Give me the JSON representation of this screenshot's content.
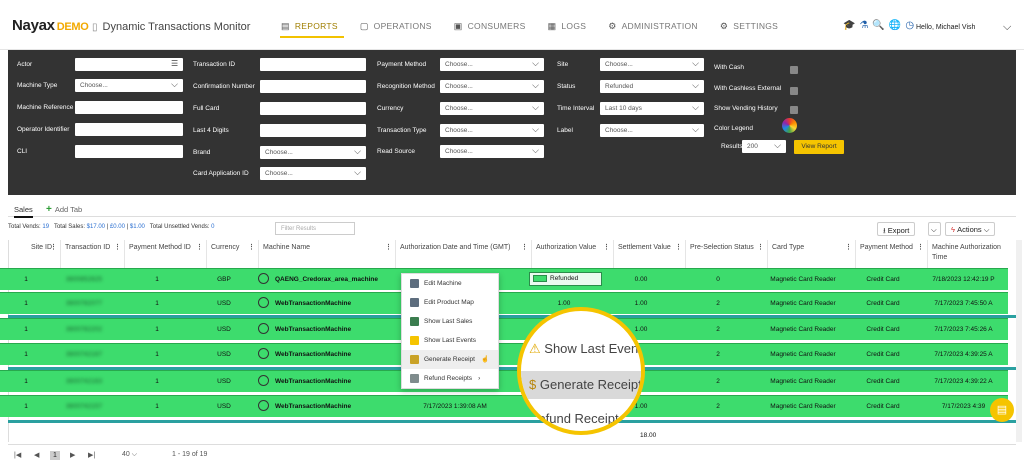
{
  "header": {
    "logo": "Nayax",
    "logo_demo": "DEMO",
    "app_title": "Dynamic Transactions Monitor",
    "nav": [
      {
        "label": "REPORTS",
        "glyph": "▤"
      },
      {
        "label": "OPERATIONS",
        "glyph": "▢"
      },
      {
        "label": "CONSUMERS",
        "glyph": "▣"
      },
      {
        "label": "LOGS",
        "glyph": "▦"
      },
      {
        "label": "ADMINISTRATION",
        "glyph": "⚙"
      },
      {
        "label": "SETTINGS",
        "glyph": "⚙"
      }
    ],
    "user_greeting": "Hello, Michael Vish"
  },
  "filters": {
    "col1": [
      {
        "label": "Actor",
        "value": ""
      },
      {
        "label": "Machine Type",
        "value": "Choose..."
      },
      {
        "label": "Machine Reference",
        "value": ""
      },
      {
        "label": "Operator Identifier",
        "value": ""
      },
      {
        "label": "CLI",
        "value": ""
      }
    ],
    "col2": [
      {
        "label": "Transaction ID",
        "value": ""
      },
      {
        "label": "Confirmation Number",
        "value": ""
      },
      {
        "label": "Full Card",
        "value": ""
      },
      {
        "label": "Last 4 Digits",
        "value": ""
      },
      {
        "label": "Brand",
        "value": "Choose..."
      },
      {
        "label": "Card Application ID",
        "value": "Choose..."
      }
    ],
    "col3": [
      {
        "label": "Payment Method",
        "value": "Choose..."
      },
      {
        "label": "Recognition Method",
        "value": "Choose..."
      },
      {
        "label": "Currency",
        "value": "Choose..."
      },
      {
        "label": "Transaction Type",
        "value": "Choose..."
      },
      {
        "label": "Read Source",
        "value": "Choose..."
      }
    ],
    "col4": [
      {
        "label": "Site",
        "value": "Choose..."
      },
      {
        "label": "Status",
        "value": "Refunded"
      },
      {
        "label": "Time Interval",
        "value": "Last 10 days"
      },
      {
        "label": "Label",
        "value": "Choose..."
      }
    ],
    "col5": [
      {
        "label": "With Cash"
      },
      {
        "label": "With Cashless External"
      },
      {
        "label": "Show Vending History"
      },
      {
        "label": "Color Legend"
      }
    ],
    "results_label": "Results",
    "results_value": "200",
    "view_report": "View Report"
  },
  "tabs": {
    "sales": "Sales",
    "add": "Add Tab"
  },
  "summary": {
    "total_vends_label": "Total Vends:",
    "total_vends": "19",
    "total_sales_label": "Total Sales:",
    "total_sales_1": "$17.00",
    "sep": "|",
    "total_sales_2": "£0.00",
    "total_sales_3": "$1.00",
    "unsettled_label": "Total Unsettled Vends:",
    "unsettled": "0",
    "filter_placeholder": "Filter Results",
    "export": "Export",
    "actions": "Actions"
  },
  "columns": [
    "Site ID",
    "Transaction ID",
    "Payment Method ID",
    "Currency",
    "Machine Name",
    "Authorization Date and Time (GMT)",
    "Authorization Value",
    "Settlement Value",
    "Pre-Selection Status",
    "Card Type",
    "Payment Method",
    "Machine Authorization Time"
  ],
  "rows": [
    {
      "site": "1",
      "txn": "3600852625",
      "pm": "1",
      "cur": "GBP",
      "machine": "QAENG_Credorax_area_machine",
      "auth_dt": "",
      "auth_val": "Refunded",
      "settle": "0.00",
      "pre": "0",
      "card": "Magnetic Card Reader",
      "paym": "Credit Card",
      "mtime": "7/18/2023 12:42:19 P"
    },
    {
      "site": "1",
      "txn": "3600782077",
      "pm": "1",
      "cur": "USD",
      "machine": "WebTransactionMachine",
      "auth_dt": "",
      "auth_val": "1.00",
      "settle": "1.00",
      "pre": "2",
      "card": "Magnetic Card Reader",
      "paym": "Credit Card",
      "mtime": "7/17/2023 7:45:50 A"
    },
    {
      "site": "1",
      "txn": "3600782202",
      "pm": "1",
      "cur": "USD",
      "machine": "WebTransactionMachine",
      "auth_dt": "",
      "auth_val": "",
      "settle": "1.00",
      "pre": "2",
      "card": "Magnetic Card Reader",
      "paym": "Credit Card",
      "mtime": "7/17/2023 7:45:26 A"
    },
    {
      "site": "1",
      "txn": "3600742167",
      "pm": "1",
      "cur": "USD",
      "machine": "WebTransactionMachine",
      "auth_dt": "",
      "auth_val": "",
      "settle": "",
      "pre": "2",
      "card": "Magnetic Card Reader",
      "paym": "Credit Card",
      "mtime": "7/17/2023 4:39:25 A"
    },
    {
      "site": "1",
      "txn": "3600742163",
      "pm": "1",
      "cur": "USD",
      "machine": "WebTransactionMachine",
      "auth_dt": "",
      "auth_val": "",
      "settle": "",
      "pre": "2",
      "card": "Magnetic Card Reader",
      "paym": "Credit Card",
      "mtime": "7/17/2023 4:39:22 A"
    },
    {
      "site": "1",
      "txn": "3600742157",
      "pm": "1",
      "cur": "USD",
      "machine": "WebTransactionMachine",
      "auth_dt": "7/17/2023 1:39:08 AM",
      "auth_val": "",
      "settle": "1.00",
      "pre": "2",
      "card": "Magnetic Card Reader",
      "paym": "Credit Card",
      "mtime": "7/17/2023 4:39"
    }
  ],
  "total_value": "18.00",
  "context_menu": [
    "Edit Machine",
    "Edit Product Map",
    "Show Last Sales",
    "Show Last Events",
    "Generate Receipt",
    "Refund Receipts"
  ],
  "magnifier": [
    "Show Last Events",
    "Generate Receipt",
    "Refund Receipt"
  ],
  "pager": {
    "first": "|◀",
    "prev": "◀",
    "page": "1",
    "next": "▶",
    "last": "▶|",
    "size": "40",
    "range": "1 - 19 of 19"
  }
}
